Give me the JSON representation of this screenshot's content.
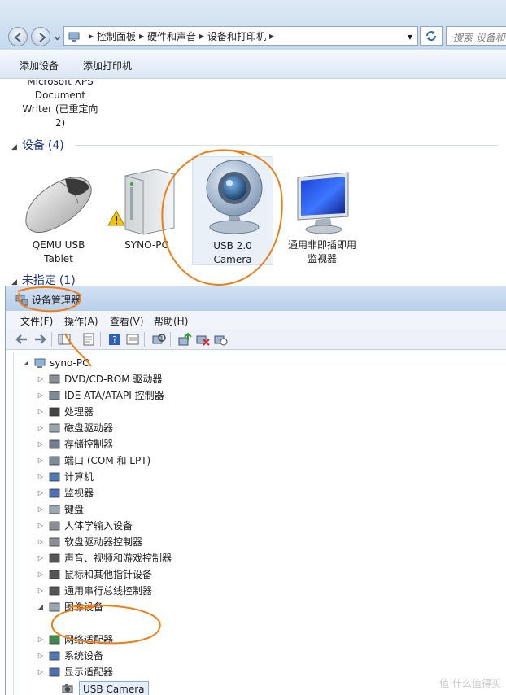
{
  "explorer": {
    "breadcrumb": [
      "控制面板",
      "硬件和声音",
      "设备和打印机"
    ],
    "search_placeholder": "搜索 设备和打印机",
    "toolbar": {
      "add_device": "添加设备",
      "add_printer": "添加打印机"
    },
    "printer_caption": "Microsoft XPS\nDocument\nWriter (已重定向\n2)",
    "devices_group": {
      "label": "设备",
      "count": "(4)"
    },
    "devices": [
      {
        "name": "QEMU USB\nTablet",
        "icon": "mouse-icon"
      },
      {
        "name": "SYNO-PC",
        "icon": "computer-tower-icon",
        "warning": true
      },
      {
        "name": "USB 2.0\nCamera",
        "icon": "webcam-icon",
        "selected": true
      },
      {
        "name": "通用非即插即用\n监视器",
        "icon": "monitor-icon"
      }
    ],
    "unspecified_group": {
      "label": "未指定",
      "count": "(1)"
    }
  },
  "devmgr": {
    "title": "设备管理器",
    "menu": [
      "文件(F)",
      "操作(A)",
      "查看(V)",
      "帮助(H)"
    ],
    "root": "syno-PC",
    "categories": [
      "DVD/CD-ROM 驱动器",
      "IDE ATA/ATAPI 控制器",
      "处理器",
      "磁盘驱动器",
      "存储控制器",
      "端口 (COM 和 LPT)",
      "计算机",
      "监视器",
      "键盘",
      "人体学输入设备",
      "软盘驱动器控制器",
      "声音、视频和游戏控制器",
      "鼠标和其他指针设备",
      "通用串行总线控制器",
      "图像设备",
      "网络适配器",
      "系统设备",
      "显示适配器"
    ],
    "imaging_child": "USB Camera"
  },
  "watermark": "值 什么值得买",
  "colors": {
    "annotation": "#f07d14",
    "link": "#1e3287",
    "selection": "#e5eefa"
  }
}
